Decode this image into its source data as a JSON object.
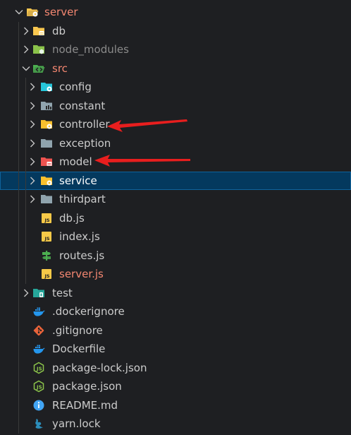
{
  "explorer": {
    "items": [
      {
        "label": "server",
        "depth": 0,
        "kind": "folder-open",
        "icon": "server-folder-icon",
        "color": "#f9c74f",
        "text_style": "red"
      },
      {
        "label": "db",
        "depth": 1,
        "kind": "folder",
        "icon": "db-folder-icon",
        "color": "#f9c74f"
      },
      {
        "label": "node_modules",
        "depth": 1,
        "kind": "folder",
        "icon": "node-modules-folder-icon",
        "color": "#8bc34a",
        "text_style": "muted"
      },
      {
        "label": "src",
        "depth": 1,
        "kind": "folder-open",
        "icon": "src-folder-icon",
        "color": "#4caf50",
        "text_style": "red"
      },
      {
        "label": "config",
        "depth": 2,
        "kind": "folder",
        "icon": "config-folder-icon",
        "color": "#26c6da"
      },
      {
        "label": "constant",
        "depth": 2,
        "kind": "folder",
        "icon": "constant-folder-icon",
        "color": "#90a4ae"
      },
      {
        "label": "controller",
        "depth": 2,
        "kind": "folder",
        "icon": "controller-folder-icon",
        "color": "#fbc02d"
      },
      {
        "label": "exception",
        "depth": 2,
        "kind": "folder",
        "icon": "exception-folder-icon",
        "color": "#90a4ae"
      },
      {
        "label": "model",
        "depth": 2,
        "kind": "folder",
        "icon": "model-folder-icon",
        "color": "#ef5350"
      },
      {
        "label": "service",
        "depth": 2,
        "kind": "folder",
        "icon": "service-folder-icon",
        "color": "#fbc02d",
        "selected": true
      },
      {
        "label": "thirdpart",
        "depth": 2,
        "kind": "folder",
        "icon": "thirdpart-folder-icon",
        "color": "#90a4ae"
      },
      {
        "label": "db.js",
        "depth": 2,
        "kind": "file",
        "icon": "javascript-file-icon",
        "color": "#f7c948"
      },
      {
        "label": "index.js",
        "depth": 2,
        "kind": "file",
        "icon": "javascript-file-icon",
        "color": "#f7c948"
      },
      {
        "label": "routes.js",
        "depth": 2,
        "kind": "file",
        "icon": "routes-file-icon",
        "color": "#4caf50"
      },
      {
        "label": "server.js",
        "depth": 2,
        "kind": "file",
        "icon": "javascript-file-icon",
        "color": "#f7c948",
        "text_style": "red"
      },
      {
        "label": "test",
        "depth": 1,
        "kind": "folder",
        "icon": "test-folder-icon",
        "color": "#26a69a"
      },
      {
        "label": ".dockerignore",
        "depth": 1,
        "kind": "file",
        "icon": "docker-icon",
        "color": "#2496ed"
      },
      {
        "label": ".gitignore",
        "depth": 1,
        "kind": "file",
        "icon": "git-icon",
        "color": "#e8633a"
      },
      {
        "label": "Dockerfile",
        "depth": 1,
        "kind": "file",
        "icon": "docker-icon",
        "color": "#2496ed"
      },
      {
        "label": "package-lock.json",
        "depth": 1,
        "kind": "file",
        "icon": "nodejs-icon",
        "color": "#8bc34a"
      },
      {
        "label": "package.json",
        "depth": 1,
        "kind": "file",
        "icon": "nodejs-icon",
        "color": "#8bc34a"
      },
      {
        "label": "README.md",
        "depth": 1,
        "kind": "file",
        "icon": "info-icon",
        "color": "#42a5f5"
      },
      {
        "label": "yarn.lock",
        "depth": 1,
        "kind": "file",
        "icon": "yarn-icon",
        "color": "#2c8ebb"
      }
    ]
  },
  "annotations": {
    "arrow_color": "#e81e1e",
    "arrows": [
      {
        "points_to": "controller"
      },
      {
        "points_to": "model"
      }
    ]
  }
}
